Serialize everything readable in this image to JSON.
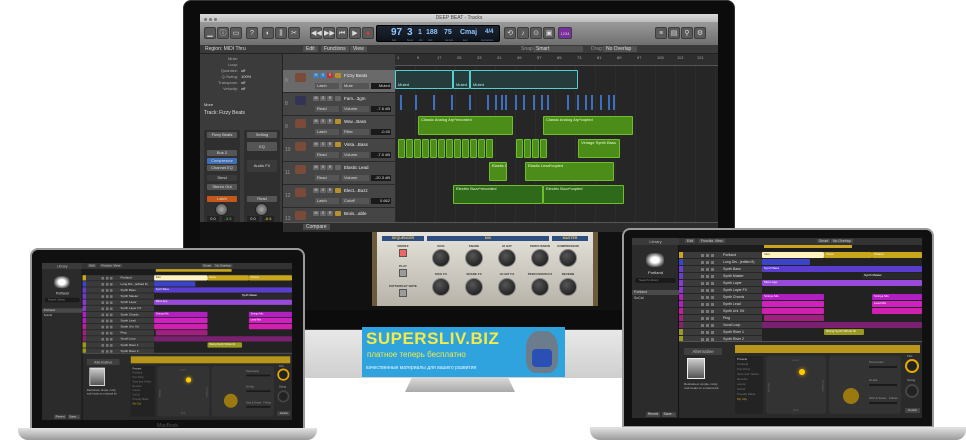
{
  "imac": {
    "window_title": "DEEP BEAT - Tracks",
    "toolbar_icons": [
      "library-icon",
      "inspector-icon",
      "toolbar-icon",
      "help-icon",
      "smart-controls-icon",
      "mixer-icon",
      "editors-icon",
      "rewind-icon",
      "forward-icon",
      "to-start-icon",
      "play-icon",
      "record-icon",
      "cycle-icon",
      "tuner-icon",
      "count-in-icon",
      "metronome-icon",
      "list-editors-icon",
      "notepad-icon",
      "loop-browser-icon",
      "browsers-icon"
    ],
    "lcd": {
      "bar": "97",
      "beat": "3",
      "div": "1",
      "tick": "188",
      "tempo": "75",
      "key": "Cmaj",
      "signature": "4/4",
      "labels": {
        "bar": "bar",
        "beat": "beat",
        "div": "div",
        "tick": "tick",
        "tempo": "tempo",
        "key": "key",
        "signature": "signature"
      }
    },
    "count_badge": "1234",
    "menus": {
      "edit": "Edit",
      "functions": "Functions",
      "view": "View",
      "snap_label": "Snap:",
      "snap": "Smart",
      "drag_label": "Drag:",
      "drag": "No Overlap"
    },
    "inspector": {
      "region_header": "Region: MIDI Thru",
      "params": [
        {
          "label": "Mute:",
          "value": ""
        },
        {
          "label": "Loop:",
          "value": ""
        },
        {
          "label": "Quantize:",
          "value": "off"
        },
        {
          "label": "Q-Swing:",
          "value": "100%"
        },
        {
          "label": "Transpose:",
          "value": "off"
        },
        {
          "label": "Velocity:",
          "value": "off"
        }
      ],
      "more": "More",
      "track_header": "Track: Fizzy Beats",
      "strip1": {
        "name": "Fizzy Beats",
        "bus": "Bus 2",
        "plugin1": "Compressor",
        "plugin2": "Channel EQ",
        "send": "Send",
        "output": "Stereo Out",
        "mode": "Latch",
        "vol": "0.0",
        "peak": "-3.5"
      },
      "strip2": {
        "name": "Setting",
        "eq": "EQ",
        "audio_fx": "Audio FX",
        "mode": "Read",
        "vol": "0.0",
        "peak": "-8.6"
      }
    },
    "ruler": [
      "1",
      "9",
      "17",
      "25",
      "33",
      "41",
      "49",
      "57",
      "65",
      "73",
      "81",
      "89",
      "97",
      "105",
      "113",
      "121"
    ],
    "tracks": [
      {
        "num": "8",
        "name": "Fizzy Beats",
        "mode": "Latch",
        "param": "Mute",
        "value": "Muted"
      },
      {
        "num": "8",
        "name": "Fam...3gm",
        "mode": "Read",
        "param": "Volume",
        "value": "-7.6 dB"
      },
      {
        "num": "9",
        "name": "Wav...Bass",
        "mode": "Latch",
        "param": "Filter",
        "value": "-0.40"
      },
      {
        "num": "10",
        "name": "Vinta...Bass",
        "mode": "Read",
        "param": "Volume",
        "value": "-7.0 dB"
      },
      {
        "num": "11",
        "name": "Elastic Lead",
        "mode": "Read",
        "param": "Volume",
        "value": "-20.3 dB"
      },
      {
        "num": "12",
        "name": "Elect...Buzz",
        "mode": "Latch",
        "param": "Cutoff",
        "value": "0.662"
      },
      {
        "num": "13",
        "name": "Brois...able",
        "mode": "",
        "param": "",
        "value": ""
      }
    ],
    "regions": {
      "muted": "Muted",
      "arp_rec": "Classic Analog Arp*recorded",
      "arp_copy": "Classic Analog Arp*copied",
      "vintage": "Vintage Synth Bass",
      "elastic": "Elastic L",
      "elastic_copy": "Elastic Lead*copied",
      "buzz_rec": "Electric Buzz*recorded",
      "buzz_copy": "Electric Buzz*copied"
    },
    "compare": "Compare",
    "plugin": {
      "sections": {
        "sequencer": "SEQUENCER",
        "mix": "MIX",
        "master": "MASTER"
      },
      "buttons": [
        "ON/OFF",
        "PLAY",
        "PATTERN BY NOTE"
      ],
      "knobs_top": [
        "KICK",
        "SNARE",
        "HI HAT",
        "PERCUSSION",
        "COMPRESSOR"
      ],
      "knobs_bottom": [
        "KICK FX",
        "SNARE FX",
        "HI HAT FX",
        "PERCUSSION FX",
        "REVERB"
      ]
    }
  },
  "banner": {
    "title": "SUPERSLIV.BIZ",
    "line1": "платное теперь бесплатно",
    "line2": "качественные материалы для вашего развития"
  },
  "laptop": {
    "brand": "MacBook",
    "library": {
      "title": "Library",
      "patch": "Portland",
      "search": "Search Library",
      "items": [
        "Portland",
        "SoCal"
      ],
      "revert": "Revert",
      "save": "Save..."
    },
    "menus": [
      "Edit",
      "Functions",
      "View",
      "Smart",
      "No Overlap"
    ],
    "tracks": [
      "Portland",
      "Long Dis...(edited 8)",
      "Synth Bass",
      "Synth Master",
      "Synth Layer",
      "Synth Layer FX",
      "Synth Chords",
      "Synth Lead",
      "Synth Uni. Kit",
      "Ping",
      "Vocal Loop",
      "Synth Riser 1",
      "Synth Riser 2"
    ],
    "region_labels": {
      "intro": "Intro",
      "verse": "Verse",
      "chorus": "Chorus",
      "bass": "Synth Bass",
      "master": "Synth Master",
      "arp": "Micro App",
      "strings": "Strings Mix",
      "lead": "Lead Mix",
      "riser": "Rising Synth Whole Nt"
    },
    "editor": {
      "alternative": "Alternative",
      "description": "Restrained, simple, rocky rock beats on a natural kit.",
      "presets_label": "Presets",
      "presets": [
        "Portland",
        "Pop Drive",
        "Slow and Yellow",
        "Resolve",
        "Lancer",
        "SoCal",
        "Proudly Made",
        "My City"
      ],
      "loud": "Loud",
      "soft": "Soft",
      "simple": "Simple",
      "complex": "Complex",
      "percussion": "Percussion",
      "hihat": "Hi-Hat",
      "kick_snare": "Kick & Snare",
      "follow": "Follow",
      "fills": "Fills",
      "swing": "Swing",
      "details": "Details"
    }
  }
}
